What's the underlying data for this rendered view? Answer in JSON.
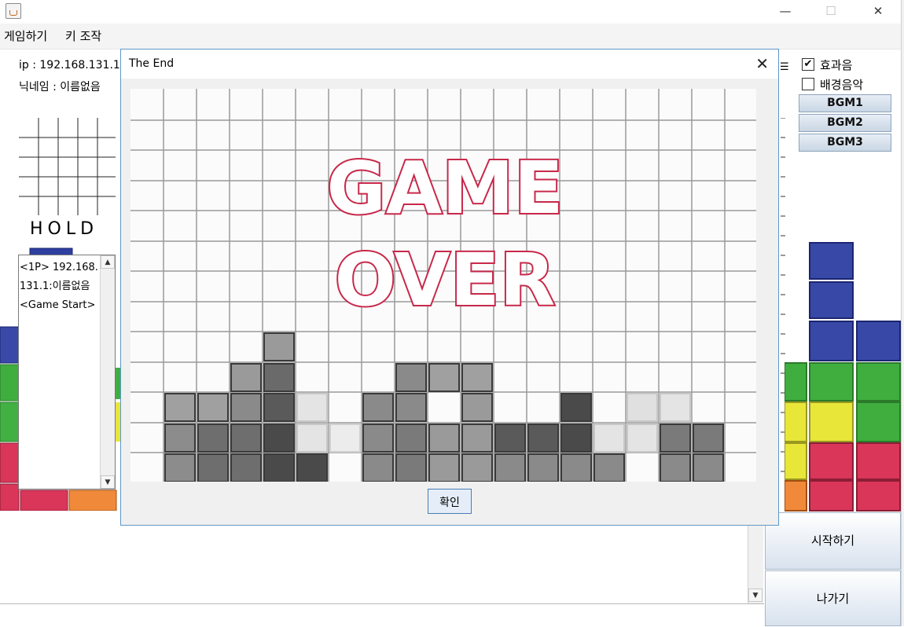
{
  "window": {
    "minimize_glyph": "—",
    "maximize_glyph": "☐",
    "close_glyph": "✕"
  },
  "menu": {
    "items": [
      "게임하기",
      "키 조작"
    ]
  },
  "player": {
    "ip": "ip : 192.168.131.1",
    "nickname": "닉네임 : 이름없음"
  },
  "hold": {
    "label": "HOLD"
  },
  "chat": {
    "lines": [
      "<1P> 192.168.131.1:이름없음",
      "<Game Start>"
    ],
    "up_arrow": "▲",
    "down_arrow": "▼"
  },
  "dialog": {
    "title": "The End",
    "close_glyph": "✕",
    "image_text": [
      "GAME",
      "OVER"
    ],
    "confirm": "확인"
  },
  "options": {
    "sound_effect": {
      "label": "효과음",
      "checked": true
    },
    "bgm_music": {
      "label": "배경음악",
      "checked": false
    },
    "bgm_buttons": [
      "BGM1",
      "BGM2",
      "BGM3"
    ]
  },
  "actions": {
    "start": "시작하기",
    "exit": "나가기"
  },
  "colors": {
    "blue": "#2f3fa0",
    "green": "#3fae3f",
    "yellow": "#e9e63a",
    "red": "#d9365a",
    "orange": "#f08a3a",
    "gameover_text": "#c8284a"
  }
}
